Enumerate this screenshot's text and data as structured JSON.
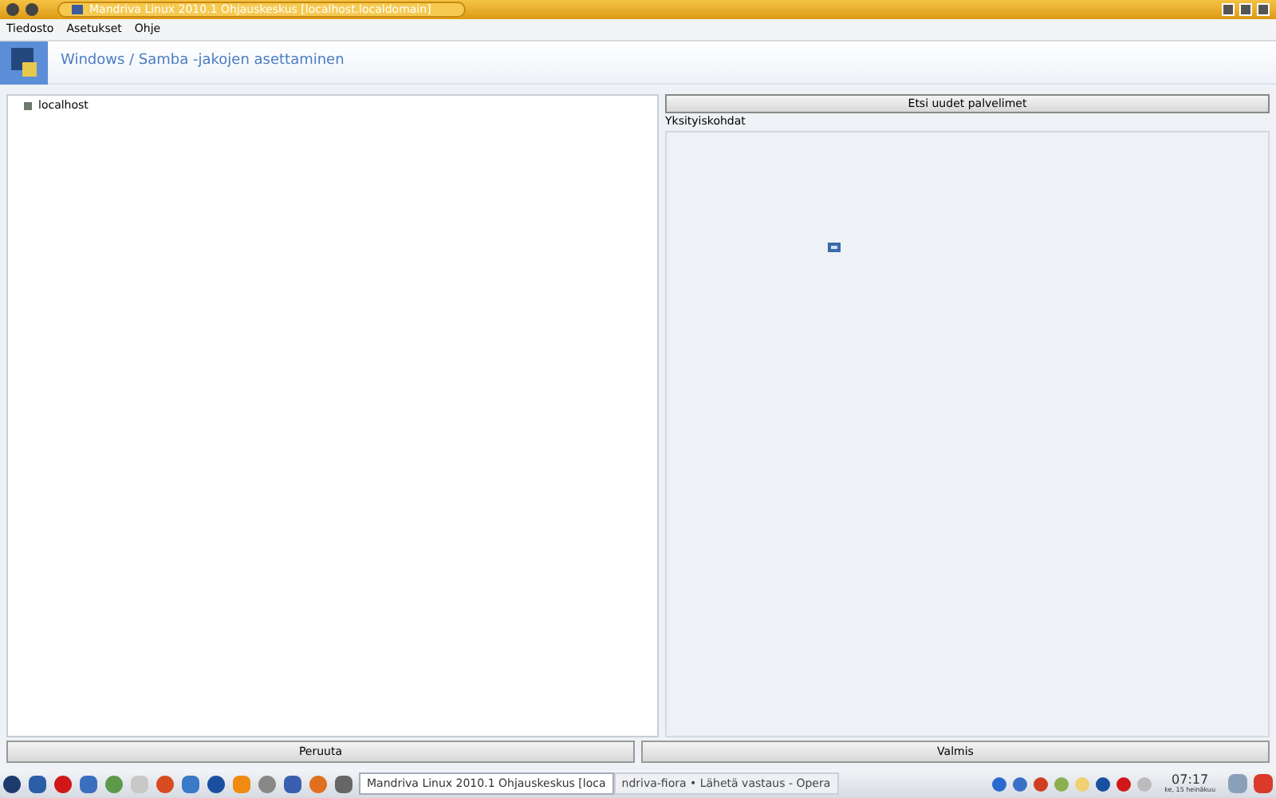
{
  "window": {
    "title": "Mandriva Linux 2010.1 Ohjauskeskus [localhost.localdomain]"
  },
  "menu": [
    "Tiedosto",
    "Asetukset",
    "Ohje"
  ],
  "header": {
    "title": "Windows / Samba -jakojen asettaminen"
  },
  "tree": {
    "items": [
      {
        "label": "localhost"
      }
    ]
  },
  "search_button": "Etsi uudet palvelimet",
  "details": {
    "title": "Yksityiskohdat"
  },
  "buttons": [
    "Peruuta",
    "Valmis"
  ],
  "taskbar": {
    "tasks": [
      {
        "label": "Mandriva Linux 2010.1 Ohjauskeskus [loca",
        "selected": true
      },
      {
        "label": "ndriva-fiora • Lähetä vastaus - Opera",
        "selected": false
      }
    ],
    "clock": {
      "time": "07:17",
      "date": "ke, 15 heinäkuu"
    }
  }
}
